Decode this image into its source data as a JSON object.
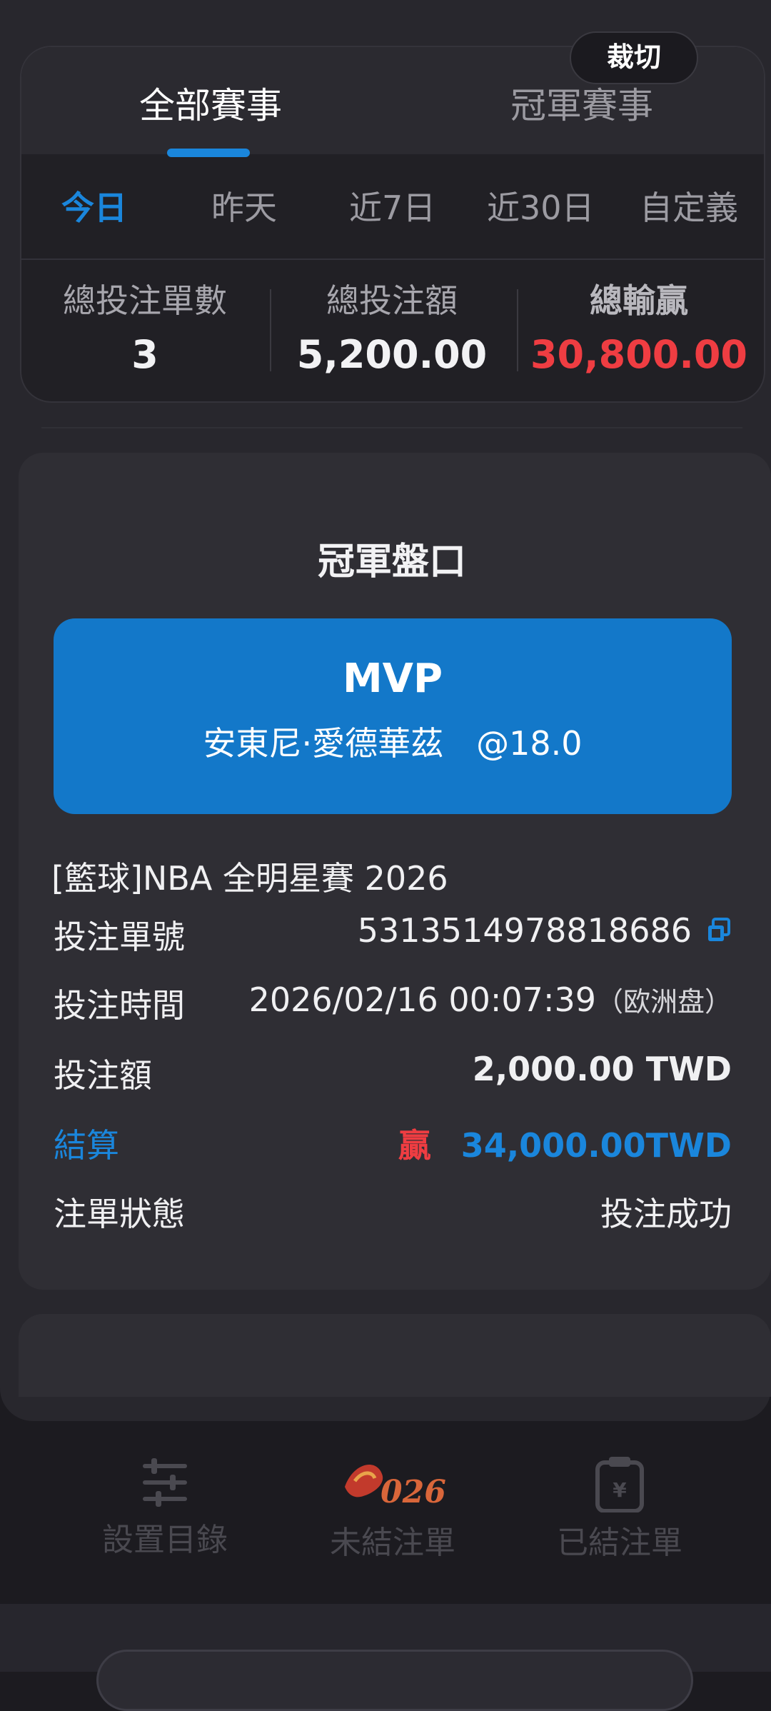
{
  "tabs": {
    "all": "全部賽事",
    "champion": "冠軍賽事"
  },
  "crop_button": "裁切",
  "date_filters": [
    "今日",
    "昨天",
    "近7日",
    "近30日",
    "自定義"
  ],
  "summary": {
    "total_bets_label": "總投注單數",
    "total_bets_value": "3",
    "total_stake_label": "總投注額",
    "total_stake_value": "5,200.00",
    "total_pl_label": "總輸贏",
    "total_pl_value": "30,800.00"
  },
  "bet": {
    "title": "冠軍盤口",
    "market_name": "MVP",
    "selection": "安東尼·愛德華茲",
    "odds": "@18.0",
    "league": "[籃球]NBA 全明星賽 2026",
    "order_no_label": "投注單號",
    "order_no_value": "5313514978818686",
    "time_label": "投注時間",
    "time_value": "2026/02/16 00:07:39",
    "odds_type": "（欧洲盘）",
    "stake_label": "投注額",
    "stake_value": "2,000.00 TWD",
    "settle_label": "結算",
    "settle_result": "贏",
    "settle_value": "34,000.00TWD",
    "status_label": "注單狀態",
    "status_value": "投注成功"
  },
  "nav": {
    "settings": "設置目錄",
    "unsettled": "未結注單",
    "settled": "已結注單"
  },
  "colors": {
    "accent": "#1a86dc",
    "loss_red": "#ef3d42",
    "card_blue": "#1378c9"
  }
}
